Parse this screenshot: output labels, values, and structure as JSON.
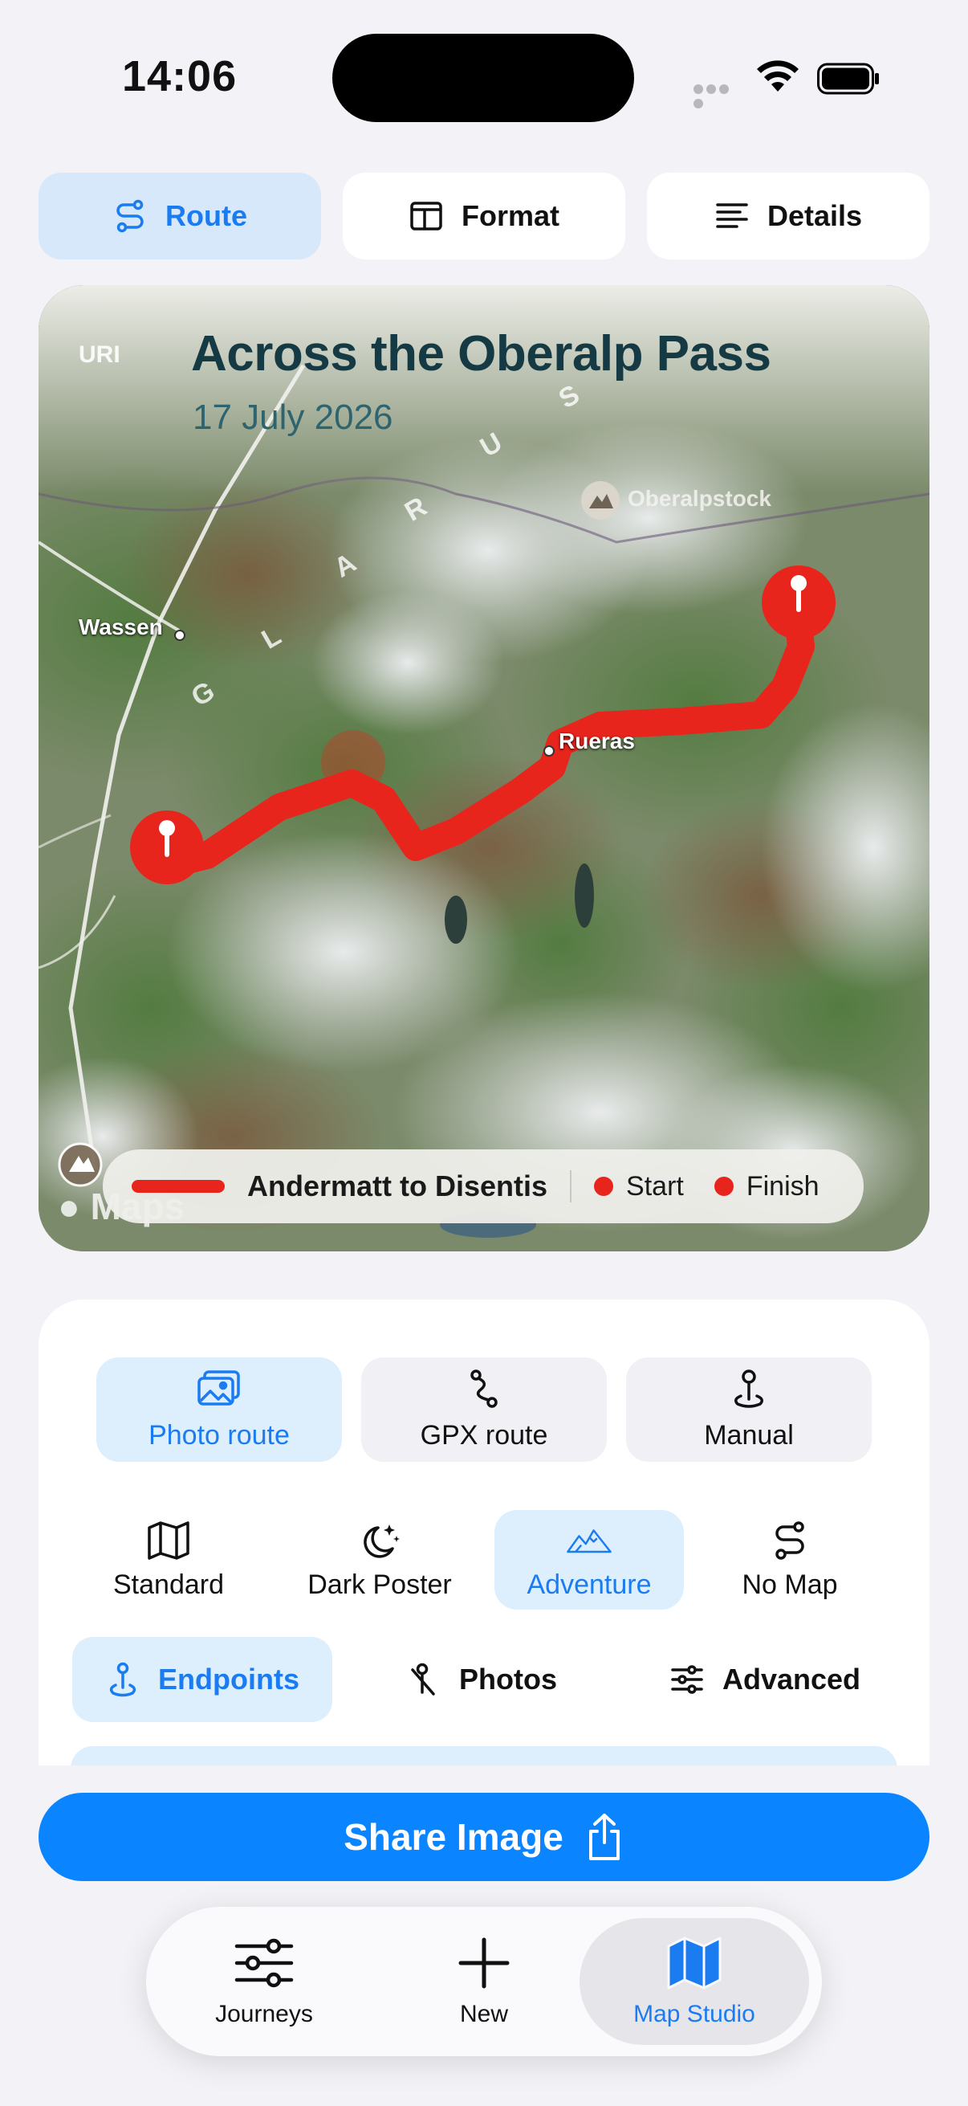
{
  "status": {
    "time": "14:06"
  },
  "top_tabs": [
    {
      "label": "Route",
      "icon": "route-icon",
      "active": true
    },
    {
      "label": "Format",
      "icon": "layout-icon",
      "active": false
    },
    {
      "label": "Details",
      "icon": "text-lines-icon",
      "active": false
    }
  ],
  "map": {
    "title": "Across the Oberalp Pass",
    "date": "17 July 2026",
    "labels": {
      "wassen": "Wassen",
      "rueras": "Rueras",
      "oberalpstock": "Oberalpstock",
      "uri": "URI",
      "glarus_letters": [
        "G",
        "L",
        "A",
        "R",
        "U",
        "S"
      ]
    },
    "attribution": "Maps",
    "legend": {
      "route_name": "Andermatt to Disentis",
      "start": "Start",
      "finish": "Finish"
    },
    "colors": {
      "route": "#e8251d",
      "title": "#163a44",
      "date": "#2e6470"
    }
  },
  "source_buttons": [
    {
      "label": "Photo route",
      "icon": "photos-icon",
      "active": true
    },
    {
      "label": "GPX route",
      "icon": "path-icon",
      "active": false
    },
    {
      "label": "Manual",
      "icon": "pin-icon",
      "active": false
    }
  ],
  "map_styles": [
    {
      "label": "Standard",
      "icon": "map-icon",
      "active": false
    },
    {
      "label": "Dark Poster",
      "icon": "moon-stars-icon",
      "active": false
    },
    {
      "label": "Adventure",
      "icon": "mountains-icon",
      "active": true
    },
    {
      "label": "No Map",
      "icon": "route-icon",
      "active": false
    }
  ],
  "sub_tabs": [
    {
      "label": "Endpoints",
      "icon": "pin-icon",
      "active": true
    },
    {
      "label": "Photos",
      "icon": "pin-slash-icon",
      "active": false
    },
    {
      "label": "Advanced",
      "icon": "sliders-icon",
      "active": false
    }
  ],
  "share": {
    "label": "Share Image",
    "icon": "share-icon"
  },
  "tab_bar": [
    {
      "label": "Journeys",
      "icon": "sliders-icon",
      "active": false
    },
    {
      "label": "New",
      "icon": "plus-icon",
      "active": false
    },
    {
      "label": "Map Studio",
      "icon": "map-fill-icon",
      "active": true
    }
  ],
  "accent": "#0a84ff"
}
